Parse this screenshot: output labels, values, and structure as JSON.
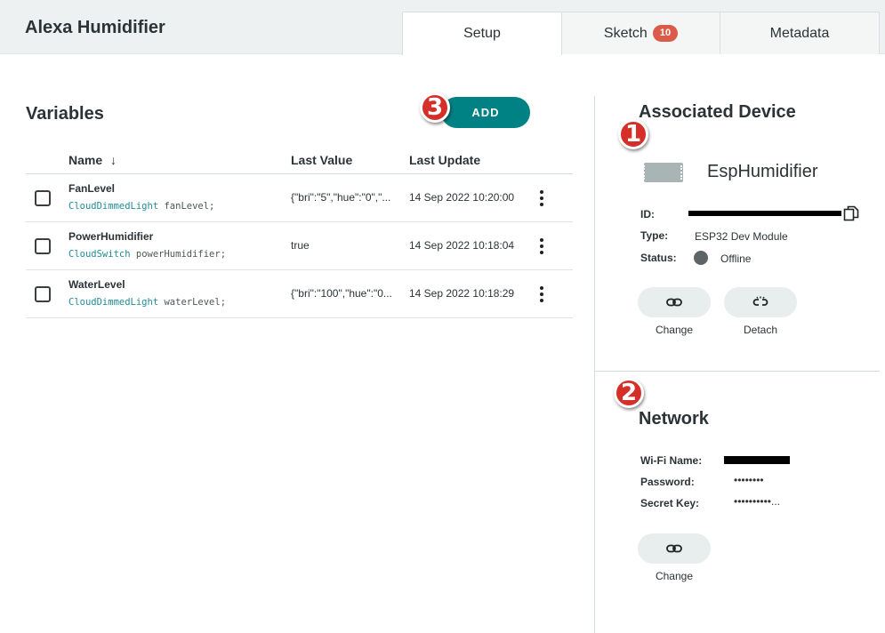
{
  "header": {
    "title": "Alexa Humidifier",
    "tabs": [
      {
        "label": "Setup",
        "active": true
      },
      {
        "label": "Sketch",
        "badge": "10"
      },
      {
        "label": "Metadata"
      }
    ]
  },
  "variables": {
    "title": "Variables",
    "add_label": "ADD",
    "columns": {
      "name": "Name",
      "sort_icon": "↓",
      "last_value": "Last Value",
      "last_update": "Last Update"
    },
    "rows": [
      {
        "name": "FanLevel",
        "type": "CloudDimmedLight",
        "decl": " fanLevel;",
        "last_value": "{\"bri\":\"5\",\"hue\":\"0\",\"...",
        "last_update": "14 Sep 2022 10:20:00"
      },
      {
        "name": "PowerHumidifier",
        "type": "CloudSwitch",
        "decl": " powerHumidifier;",
        "last_value": "true",
        "last_update": "14 Sep 2022 10:18:04"
      },
      {
        "name": "WaterLevel",
        "type": "CloudDimmedLight",
        "decl": " waterLevel;",
        "last_value": "{\"bri\":\"100\",\"hue\":\"0...",
        "last_update": "14 Sep 2022 10:18:29"
      }
    ]
  },
  "annotations": [
    "1",
    "2",
    "3"
  ],
  "device": {
    "title": "Associated Device",
    "name": "EspHumidifier",
    "id_label": "ID:",
    "type_label": "Type:",
    "type_value": "ESP32 Dev Module",
    "status_label": "Status:",
    "status_value": "Offline",
    "change_label": "Change",
    "detach_label": "Detach"
  },
  "network": {
    "title": "Network",
    "wifi_label": "Wi-Fi Name:",
    "password_label": "Password:",
    "password_value": "••••••••",
    "secret_label": "Secret Key:",
    "secret_value": "••••••••••...",
    "change_label": "Change"
  },
  "colors": {
    "accent": "#008184",
    "badge": "#da5b4a",
    "annotation": "#d62f2a"
  }
}
